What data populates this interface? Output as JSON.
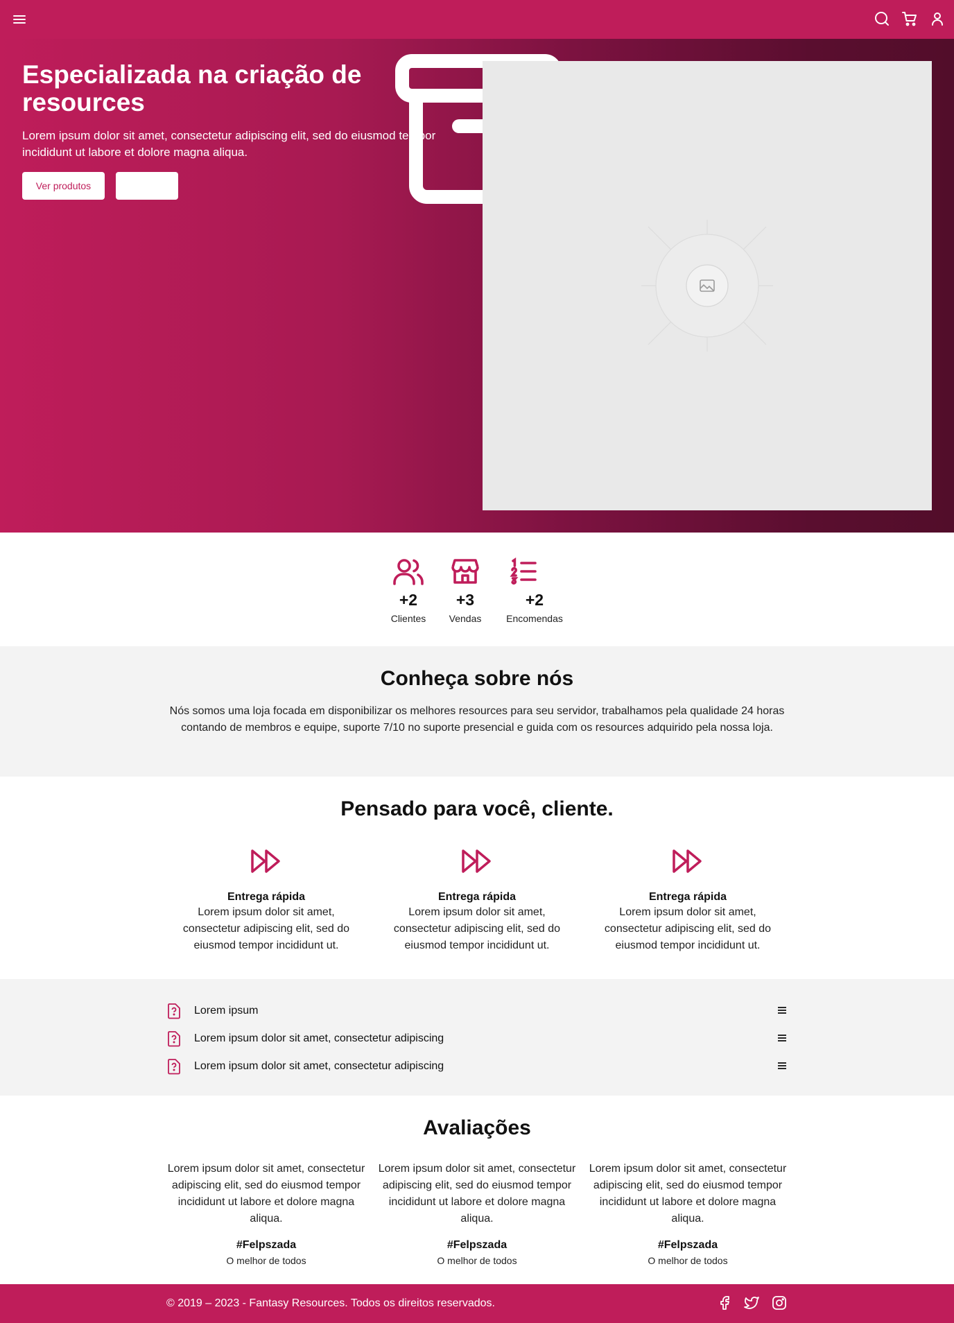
{
  "colors": {
    "brand": "#bf1d5a",
    "hero_dark": "#520d2a",
    "section_gray": "#f3f3f3",
    "placeholder": "#e9e9e9"
  },
  "nav": {
    "menu_icon": "hamburger-icon",
    "icons": [
      "search-icon",
      "cart-icon",
      "user-icon"
    ]
  },
  "hero": {
    "title": "Especializada na criação de resources",
    "description": "Lorem ipsum dolor sit amet, consectetur adipiscing elit, sed do eiusmod tempor incididunt ut labore et dolore magna aliqua.",
    "primary_button": "Ver produtos",
    "secondary_button": ""
  },
  "stats": [
    {
      "icon": "users-icon",
      "value": "+2",
      "label": "Clientes"
    },
    {
      "icon": "store-icon",
      "value": "+3",
      "label": "Vendas"
    },
    {
      "icon": "ordered-list-icon",
      "value": "+2",
      "label": "Encomendas"
    }
  ],
  "about": {
    "title": "Conheça sobre nós",
    "text": "Nós somos uma loja focada em disponibilizar os melhores resources para seu servidor, trabalhamos pela qualidade 24 horas contando de membros e equipe, suporte 7/10 no suporte presencial e guida com os resources adquirido pela nossa loja."
  },
  "features": {
    "title": "Pensado para você, cliente.",
    "items": [
      {
        "icon": "fast-forward-icon",
        "title": "Entrega rápida",
        "text": "Lorem ipsum dolor sit amet, consectetur adipiscing elit, sed do eiusmod tempor incididunt ut."
      },
      {
        "icon": "fast-forward-icon",
        "title": "Entrega rápida",
        "text": "Lorem ipsum dolor sit amet, consectetur adipiscing elit, sed do eiusmod tempor incididunt ut."
      },
      {
        "icon": "fast-forward-icon",
        "title": "Entrega rápida",
        "text": "Lorem ipsum dolor sit amet, consectetur adipiscing elit, sed do eiusmod tempor incididunt ut."
      }
    ]
  },
  "faq": [
    {
      "icon": "file-question-icon",
      "question": "Lorem ipsum"
    },
    {
      "icon": "file-question-icon",
      "question": "Lorem ipsum dolor sit amet, consectetur adipiscing"
    },
    {
      "icon": "file-question-icon",
      "question": "Lorem ipsum dolor sit amet, consectetur adipiscing"
    }
  ],
  "reviews": {
    "title": "Avaliações",
    "items": [
      {
        "text": "Lorem ipsum dolor sit amet, consectetur adipiscing elit, sed do eiusmod tempor incididunt ut labore et dolore magna aliqua.",
        "author": "#Felpszada",
        "tagline": "O melhor de todos"
      },
      {
        "text": "Lorem ipsum dolor sit amet, consectetur adipiscing elit, sed do eiusmod tempor incididunt ut labore et dolore magna aliqua.",
        "author": "#Felpszada",
        "tagline": "O melhor de todos"
      },
      {
        "text": "Lorem ipsum dolor sit amet, consectetur adipiscing elit, sed do eiusmod tempor incididunt ut labore et dolore magna aliqua.",
        "author": "#Felpszada",
        "tagline": "O melhor de todos"
      }
    ]
  },
  "footer": {
    "copyright": "© 2019 – 2023 - Fantasy Resources. Todos os direitos reservados.",
    "social_icons": [
      "facebook-icon",
      "twitter-icon",
      "instagram-icon"
    ]
  }
}
